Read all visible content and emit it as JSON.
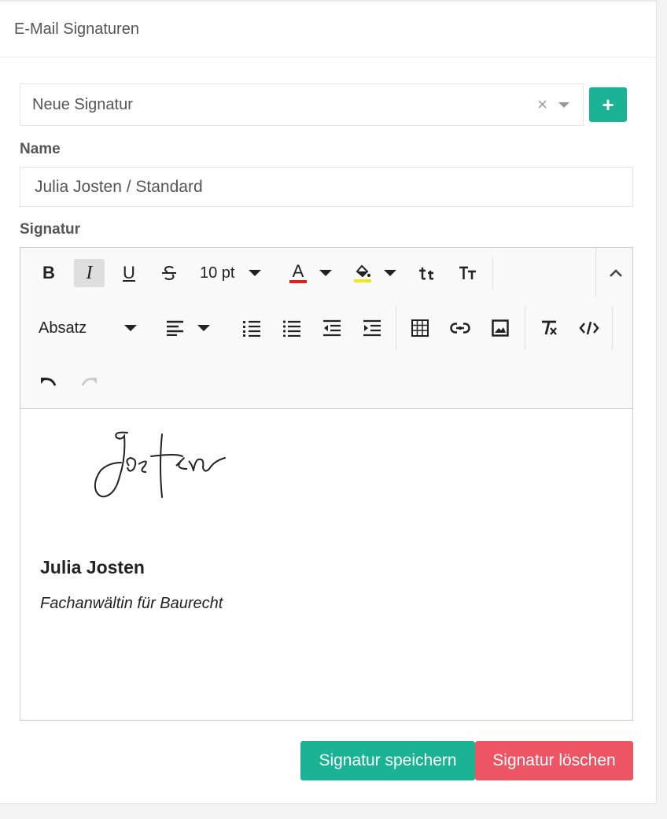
{
  "header": {
    "title": "E-Mail Signaturen"
  },
  "select": {
    "value": "Neue Signatur",
    "clear": "×",
    "add": "+"
  },
  "form": {
    "name_label": "Name",
    "name_value": "Julia Josten / Standard",
    "signature_label": "Signatur"
  },
  "toolbar": {
    "bold": "B",
    "italic": "I",
    "underline": "U",
    "font_size": "10 pt",
    "font_color_letter": "A",
    "block_format": "Absatz",
    "text_color": "#e0201c",
    "highlight_color": "#f0e81a",
    "icons": [
      "bold-icon",
      "italic-icon",
      "underline-icon",
      "strikethrough-icon",
      "font-size-select",
      "text-color-icon",
      "highlight-icon",
      "lowercase-icon",
      "capitalize-icon",
      "collapse-icon",
      "align-left-icon",
      "numbered-list-icon",
      "bullet-list-icon",
      "outdent-icon",
      "indent-icon",
      "table-icon",
      "link-icon",
      "image-icon",
      "clear-format-icon",
      "code-icon",
      "undo-icon",
      "redo-icon"
    ]
  },
  "signature": {
    "handwritten": "Josten",
    "name": "Julia Josten",
    "title": "Fachanwältin für Baurecht"
  },
  "actions": {
    "save": "Signatur speichern",
    "delete": "Signatur löschen"
  },
  "colors": {
    "primary": "#1ab394",
    "danger": "#ed5565"
  }
}
